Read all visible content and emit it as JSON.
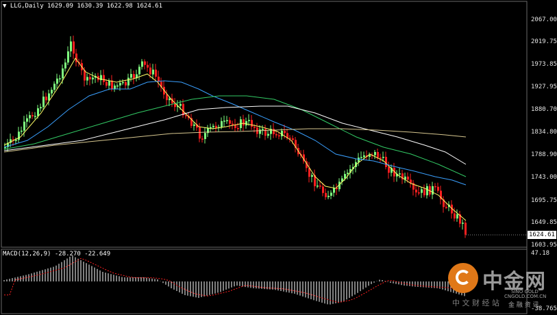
{
  "header": {
    "symbol": "LLG,Daily",
    "ohlc": "1629.09 1630.39 1622.98 1624.61"
  },
  "price_axis": {
    "ticks": [
      "2067.00",
      "2019.75",
      "1973.85",
      "1927.95",
      "1880.70",
      "1834.80",
      "1788.90",
      "1743.00",
      "1695.75",
      "1649.85",
      "1603.95"
    ],
    "current_tag": "1624.61"
  },
  "macd": {
    "label": "MACD(12,26,9) -28.270 -22.649",
    "ticks": [
      "47.18",
      "-38.765"
    ]
  },
  "watermark": {
    "brand": "中金网",
    "sub1": "SINO GOLD",
    "sub2": "CNGOLD.COM.CN",
    "sub3": "中 文  财 经  站",
    "sub4": "金 融 资 讯"
  },
  "colors": {
    "background": "#000000",
    "bull": "#7fff7f",
    "bear": "#ff2020",
    "ma_yellow": "#ffff66",
    "ma_blue": "#3aa0ff",
    "ma_green": "#33cc66",
    "ma_white": "#ffffff",
    "ma_khaki": "#d8c890",
    "macd_bar": "#ffffff",
    "macd_signal": "#ff2020"
  }
}
